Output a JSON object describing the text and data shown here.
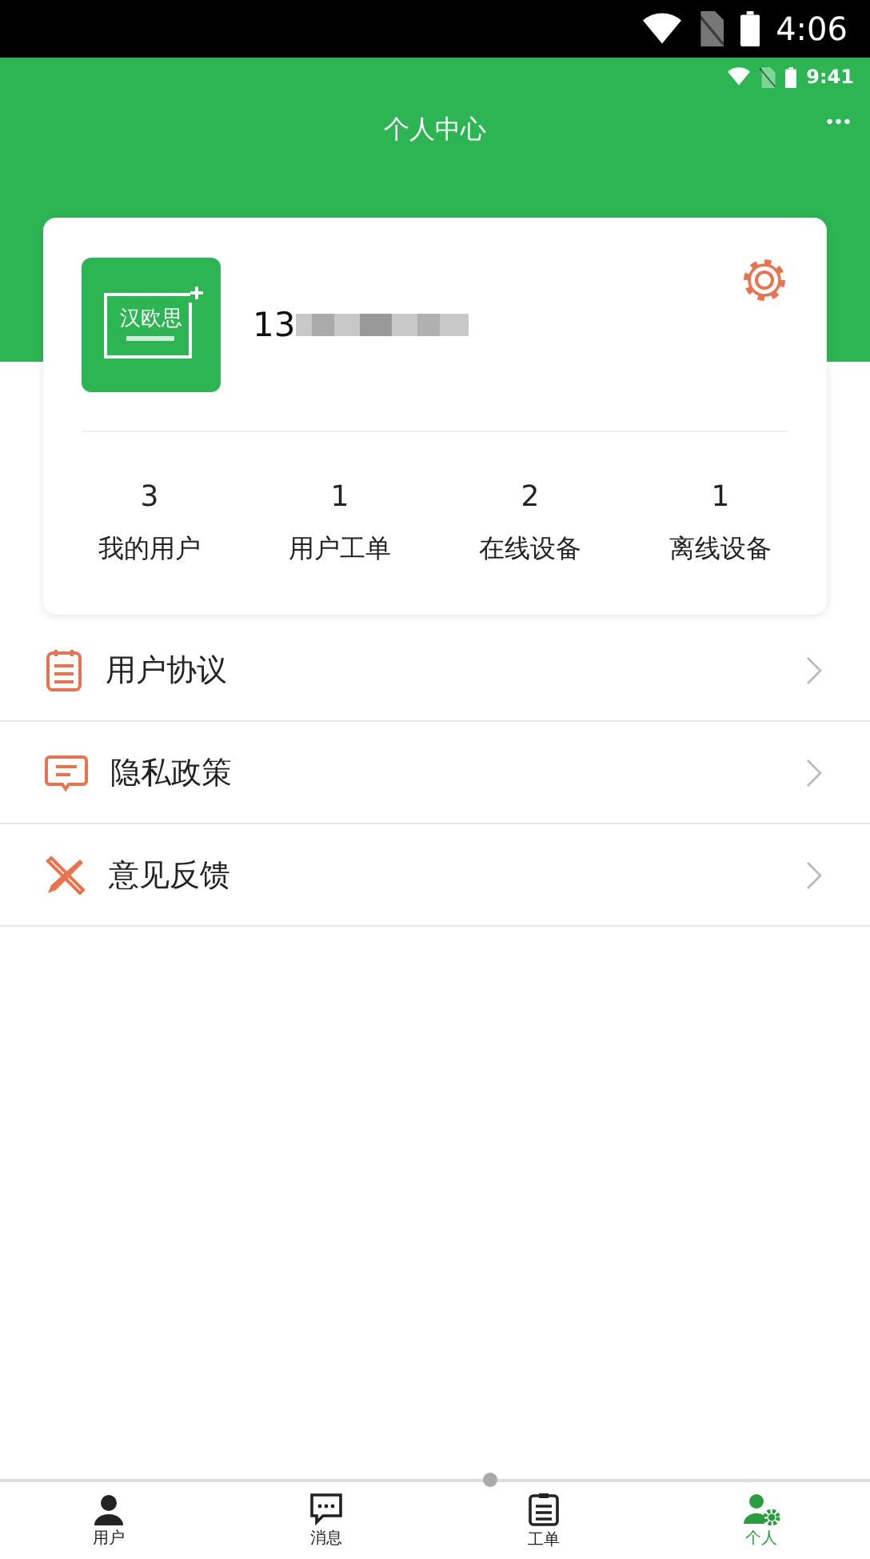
{
  "system_status": {
    "time": "4:06"
  },
  "app_status": {
    "time": "9:41"
  },
  "header": {
    "title": "个人中心",
    "more": "•••"
  },
  "profile": {
    "logo_text": "汉欧思",
    "phone_visible": "13"
  },
  "stats": [
    {
      "value": "3",
      "label": "我的用户"
    },
    {
      "value": "1",
      "label": "用户工单"
    },
    {
      "value": "2",
      "label": "在线设备"
    },
    {
      "value": "1",
      "label": "离线设备"
    }
  ],
  "menu": [
    {
      "kind": "agreement",
      "label": "用户协议"
    },
    {
      "kind": "privacy",
      "label": "隐私政策"
    },
    {
      "kind": "feedback",
      "label": "意见反馈"
    }
  ],
  "tabs": [
    {
      "kind": "user",
      "label": "用户",
      "selected": false
    },
    {
      "kind": "message",
      "label": "消息",
      "selected": false
    },
    {
      "kind": "order",
      "label": "工单",
      "selected": false
    },
    {
      "kind": "me",
      "label": "个人",
      "selected": true
    }
  ]
}
